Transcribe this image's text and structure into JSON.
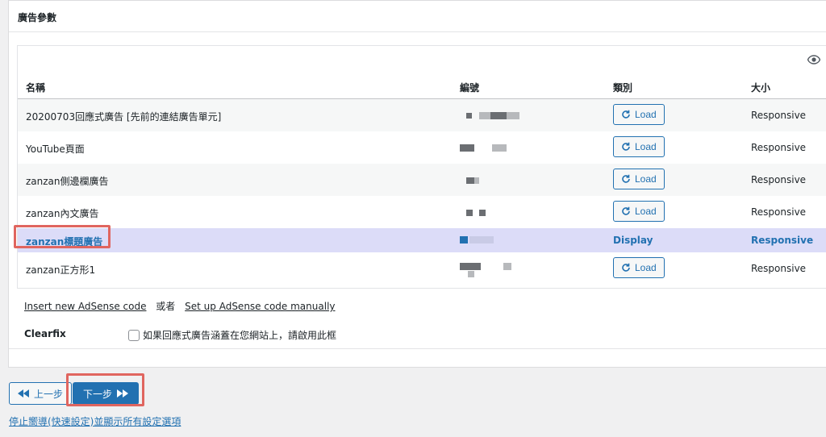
{
  "panel": {
    "title": "廣告參數"
  },
  "table": {
    "columns": {
      "name": "名稱",
      "id": "編號",
      "type": "類別",
      "size": "大小"
    },
    "load_label": "Load",
    "rows": [
      {
        "name": "20200703回應式廣告 [先前的連結廣告單元]",
        "size": "Responsive"
      },
      {
        "name": "YouTube頁面",
        "size": "Responsive"
      },
      {
        "name": "zanzan側邊欄廣告",
        "size": "Responsive"
      },
      {
        "name": "zanzan內文廣告",
        "size": "Responsive"
      },
      {
        "name": "zanzan標題廣告",
        "type": "Display",
        "size": "Responsive"
      },
      {
        "name": "zanzan正方形1",
        "size": "Responsive"
      }
    ]
  },
  "links": {
    "insert_new": "Insert new AdSense code",
    "or": "或者",
    "setup_manual": "Set up AdSense code manually"
  },
  "clearfix": {
    "label": "Clearfix",
    "checkbox_text": "如果回應式廣告涵蓋在您網站上，請啟用此框"
  },
  "nav": {
    "prev_label": "上一步",
    "next_label": "下一步",
    "stop_link": "停止嚮導(快速設定)並顯示所有設定選項"
  },
  "colors": {
    "accent": "#2271b1",
    "highlight": "#e0655f",
    "selected_row": "#dcdcf8"
  },
  "icons": {
    "eye": "eye-icon",
    "load": "refresh-icon",
    "prev": "double-chevron-left-icon",
    "next": "double-chevron-right-icon"
  }
}
